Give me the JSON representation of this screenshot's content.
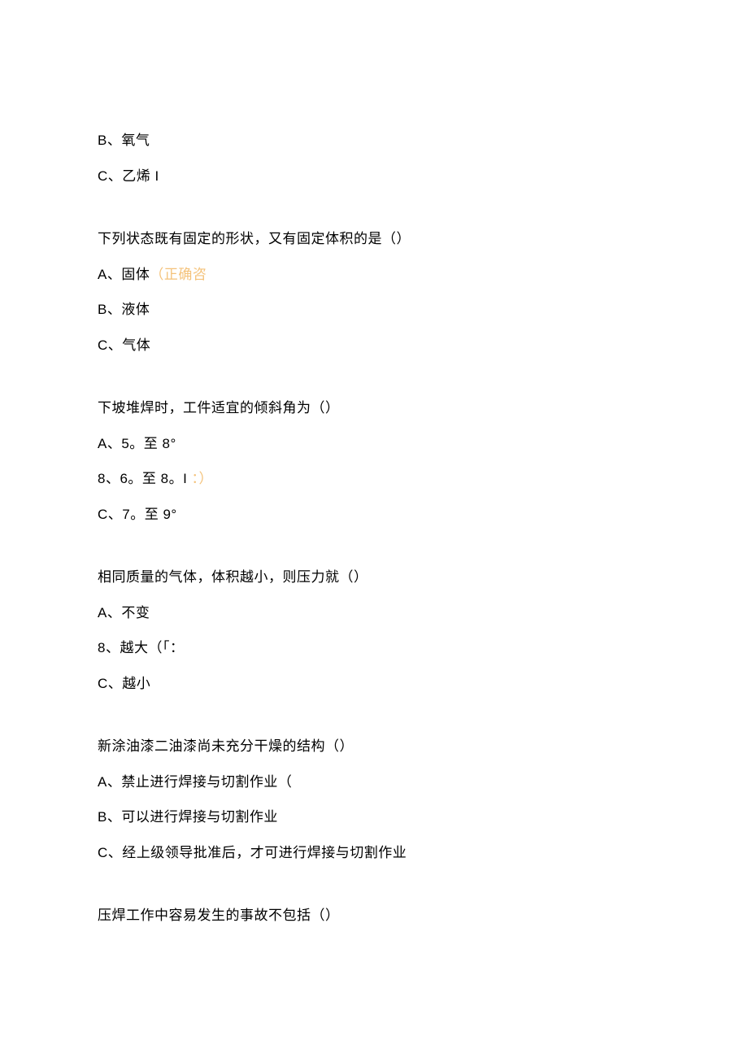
{
  "block1": {
    "optB": "B、氧气",
    "optC": "C、乙烯 I"
  },
  "q2": {
    "stem": "下列状态既有固定的形状，又有固定体积的是（）",
    "optA_prefix": "A、固体",
    "optA_hint": "（正确咨",
    "optB": "B、液体",
    "optC": "C、气体"
  },
  "q3": {
    "stem": "下坡堆焊时，工件适宜的倾斜角为（）",
    "optA": "A、5。至 8°",
    "optB_prefix": "8、6。至 8。I",
    "optB_hint": "   ：）",
    "optC": "C、7。至 9°"
  },
  "q4": {
    "stem": "相同质量的气体，体积越小，则压力就（）",
    "optA": "A、不变",
    "optB": "8、越大（「：",
    "optC": "C、越小"
  },
  "q5": {
    "stem": "新涂油漆二油漆尚未充分干燥的结构（）",
    "optA": "A、禁止进行焊接与切割作业（",
    "optB": "B、可以进行焊接与切割作业",
    "optC": "C、经上级领导批准后，才可进行焊接与切割作业"
  },
  "q6": {
    "stem": "压焊工作中容易发生的事故不包括（）"
  }
}
